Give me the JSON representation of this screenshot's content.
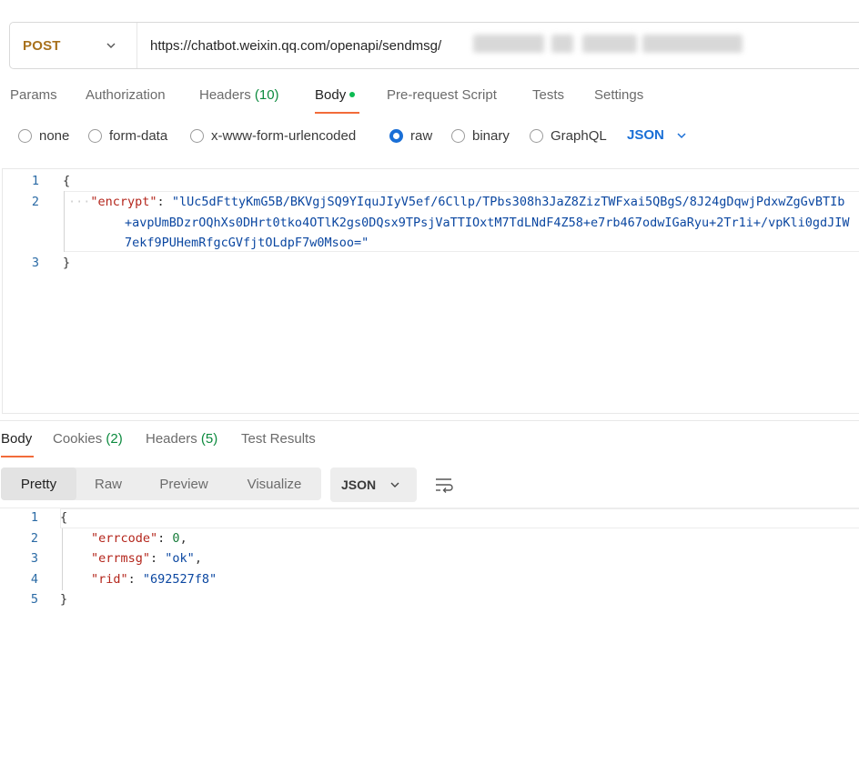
{
  "request": {
    "method": "POST",
    "url": "https://chatbot.weixin.qq.com/openapi/sendmsg/"
  },
  "request_tabs": [
    {
      "label": "Params"
    },
    {
      "label": "Authorization"
    },
    {
      "label": "Headers",
      "count": "(10)"
    },
    {
      "label": "Body",
      "active": true
    },
    {
      "label": "Pre-request Script"
    },
    {
      "label": "Tests"
    },
    {
      "label": "Settings"
    }
  ],
  "body_types": [
    {
      "label": "none"
    },
    {
      "label": "form-data"
    },
    {
      "label": "x-www-form-urlencoded"
    },
    {
      "label": "raw",
      "checked": true
    },
    {
      "label": "binary"
    },
    {
      "label": "GraphQL"
    }
  ],
  "body_language": "JSON",
  "request_body": {
    "line_numbers": [
      "1",
      "2",
      "3"
    ],
    "open_brace": "{",
    "close_brace": "}",
    "key": "\"encrypt\"",
    "colon": ": ",
    "value_line1": "\"lUc5dFttyKmG5B/BKVgjSQ9YIquJIyV5ef/6Cllp/TPbs308h3JaZ8ZizTWFxai5QBgS/8J24gDqwjPdxwZgGvBTIb",
    "value_line2": "+avpUmBDzrOQhXs0DHrt0tko4OTlK2gs0DQsx9TPsjVaTTIOxtM7TdLNdF4Z58+e7rb467odwIGaRyu+2Tr1i+/vpKli0gdJIW",
    "value_line3": "7ekf9PUHemRfgcGVfjtOLdpF7w0Msoo=\""
  },
  "response_tabs": [
    {
      "label": "Body",
      "active": true
    },
    {
      "label": "Cookies",
      "count": "(2)"
    },
    {
      "label": "Headers",
      "count": "(5)"
    },
    {
      "label": "Test Results"
    }
  ],
  "view_modes": [
    "Pretty",
    "Raw",
    "Preview",
    "Visualize"
  ],
  "active_view_mode": "Pretty",
  "response_format": "JSON",
  "response_body": {
    "line_numbers": [
      "1",
      "2",
      "3",
      "4",
      "5"
    ],
    "open_brace": "{",
    "close_brace": "}",
    "errcode_key": "\"errcode\"",
    "errcode_value": "0",
    "errmsg_key": "\"errmsg\"",
    "errmsg_value": "\"ok\"",
    "rid_key": "\"rid\"",
    "rid_value": "\"692527f8\""
  },
  "colors": {
    "method": "#a8711c",
    "accent_tab": "#f26b3a",
    "active_radio": "#1a6fd6",
    "count_green": "#0c8a3e",
    "json_key": "#b4261c",
    "json_string": "#0b47a1"
  }
}
